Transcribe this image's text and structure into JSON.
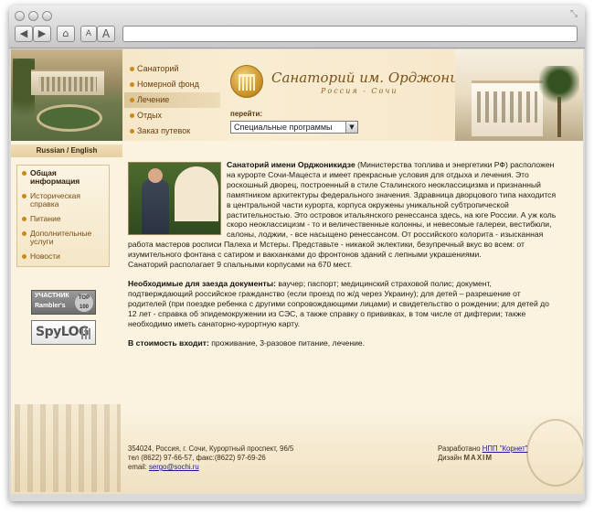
{
  "browser": {
    "back_icon": "◀",
    "forward_icon": "▶",
    "home_icon": "⌂",
    "text_small": "A",
    "text_large": "A",
    "url": ""
  },
  "header": {
    "nav": [
      {
        "label": "Санаторий"
      },
      {
        "label": "Номерной фонд"
      },
      {
        "label": "Лечение",
        "active": true
      },
      {
        "label": "Отдых"
      },
      {
        "label": "Заказ путевок"
      }
    ],
    "title": "Санаторий им. Орджоникидзе",
    "subtitle": "Россия - Сочи",
    "goto_label": "перейти:",
    "goto_value": "Специальные программы"
  },
  "lang_switch": "Russian / English",
  "sidebar": {
    "items": [
      {
        "label": "Общая информация",
        "active": true
      },
      {
        "label": "Историческая справка"
      },
      {
        "label": "Питание"
      },
      {
        "label": "Дополнительные услуги"
      },
      {
        "label": "Новости"
      }
    ],
    "badge_rambler": {
      "line1": "УЧАСТНИК",
      "line2": "Rambler's",
      "top": "TOP 100"
    },
    "badge_spylog": "SpyLOG"
  },
  "article": {
    "p1_bold": "Санаторий имени Орджоникидзе",
    "p1_text": " (Министерства топлива и энергетики РФ) расположен на курорте Сочи-Мацеста и имеет прекрасные условия для отдыха и лечения. Это роскошный дворец, построенный в стиле Сталинского неоклассицизма и признанный памятником архитектуры федерального значения. Здравница дворцового типа находится в центральной части курорта, корпуса окружены уникальной субтропической растительностью. Это островок итальянского ренессанса здесь, на юге России. А уж коль скоро неоклассицизм - то и величественные колонны, и невесомые галереи, вестибюли, салоны, лоджии, - все насыщено ренессансом. От российского колорита - изысканная работа мастеров росписи Палеха и Мстеры. Представьте - никакой эклектики, безупречный вкус во всем: от изумительного фонтана с сатиром и вакханками до фронтонов зданий с лепными украшениями.",
    "p1_last": "Санаторий располагает 9 спальными корпусами на 670 мест.",
    "p2_bold": "Необходимые для заезда документы:",
    "p2_text": " ваучер; паспорт; медицинский страховой полис; документ, подтверждающий российское гражданство (если проезд по ж/д через Украину); для детей – разрешение от родителей (при поездке ребенка с другими сопровождающими лицами) и свидетельство о рождении; для детей до 12 лет - справка об эпидемокружении из СЭС, а также справку о прививках, в том числе от дифтерии; также необходимо иметь санаторно-курортную карту.",
    "p3_bold": "В стоимость входит:",
    "p3_text": " проживание, 3-разовое питание, лечение."
  },
  "footer": {
    "address": "354024, Россия, г. Сочи, Курортный проспект, 96/5",
    "phone": "тел (8622) 97-66-57, факс:(8622) 97-69-26",
    "email_label": "email: ",
    "email": "sergo@sochi.ru",
    "dev_label": "Разработано ",
    "dev_name": "НПП \"Корнет\"",
    "design_label": "Дизайн ",
    "design_name": "MAXIM"
  }
}
